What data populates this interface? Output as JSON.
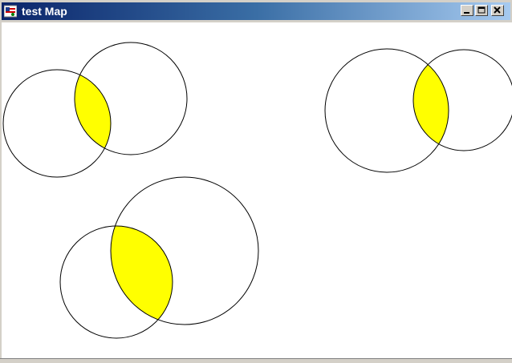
{
  "window": {
    "title": "test Map",
    "icon": "map-app-icon",
    "controls": [
      {
        "name": "minimize",
        "icon": "minimize-icon"
      },
      {
        "name": "maximize",
        "icon": "maximize-icon"
      },
      {
        "name": "close",
        "icon": "close-icon"
      }
    ]
  },
  "map": {
    "intersection_color": "#ffff00",
    "stroke_color": "#000000",
    "circle_pairs": 3
  }
}
